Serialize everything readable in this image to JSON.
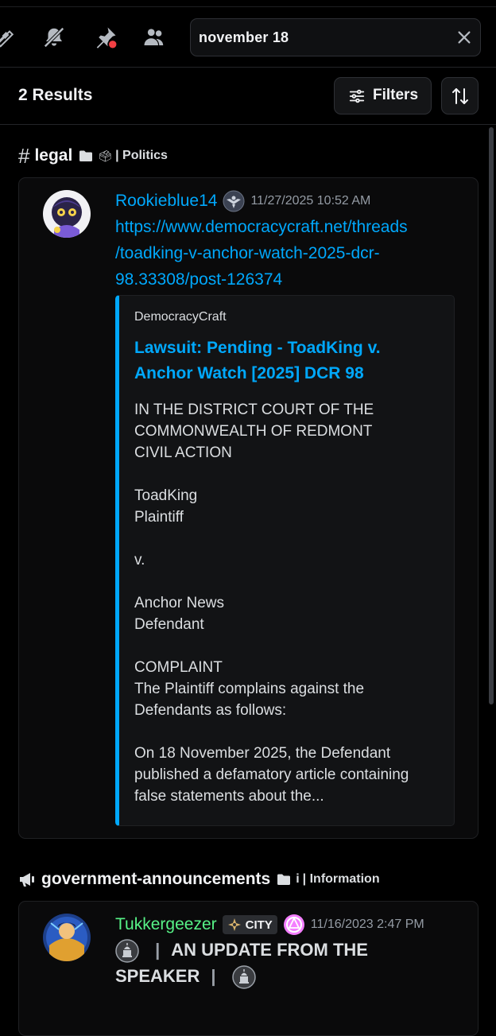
{
  "toolbar": {
    "icons": [
      "threads-icon",
      "mute-bell-icon",
      "pin-icon",
      "members-icon"
    ],
    "search": {
      "value": "november 18"
    }
  },
  "results": {
    "count_label": "2 Results",
    "filters_label": "Filters"
  },
  "groups": [
    {
      "channel": "legal",
      "category_emoji": "🗳",
      "category": "| Politics",
      "message": {
        "author": "Rookieblue14",
        "author_color": "#00a8fc",
        "timestamp": "11/27/2025 10:52 AM",
        "link_lines": [
          "https://www.democracycraft.net/threads",
          "/toadking-v-anchor-watch-2025-dcr-",
          "98.33308/post-126374"
        ],
        "embed": {
          "provider": "DemocracyCraft",
          "title": "Lawsuit: Pending - ToadKing v. Anchor Watch [2025] DCR 98",
          "description": "IN THE DISTRICT COURT OF THE\nCOMMONWEALTH OF REDMONT\nCIVIL ACTION\n\nToadKing\nPlaintiff\n\nv.\n\nAnchor News\nDefendant\n\nCOMPLAINT\nThe Plaintiff complains against the\nDefendants as follows:\n\nOn 18 November 2025, the Defendant\npublished a defamatory article containing\nfalse statements about the...",
          "accent_color": "#00a8fc"
        }
      }
    },
    {
      "channel": "government-announcements",
      "category_emoji": "i",
      "category": "| Information",
      "message": {
        "author": "Tukkergeezer",
        "author_color": "#57f287",
        "badge": "CITY",
        "timestamp": "11/16/2023 2:47 PM",
        "content_part1": "AN UPDATE FROM THE",
        "content_part2": "SPEAKER"
      }
    }
  ]
}
